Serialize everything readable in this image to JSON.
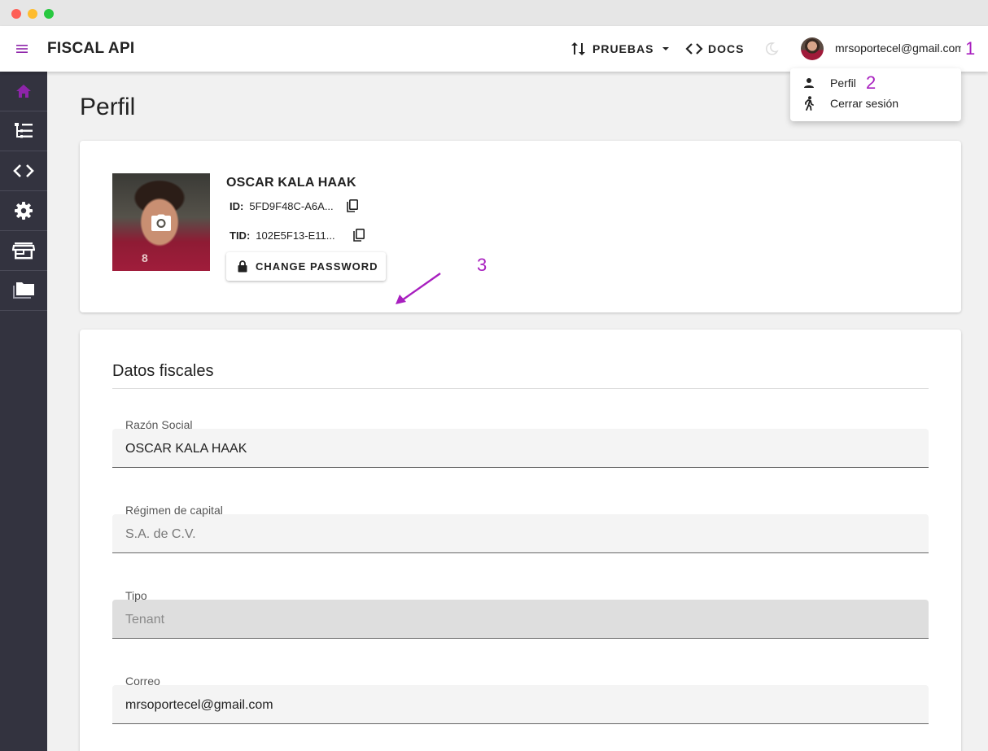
{
  "app": {
    "title": "FISCAL API"
  },
  "header": {
    "env_label": "PRUEBAS",
    "docs_label": "DOCS",
    "user_email": "mrsoportecel@gmail.com"
  },
  "user_menu": {
    "items": [
      {
        "label": "Perfil",
        "icon": "person-icon"
      },
      {
        "label": "Cerrar sesión",
        "icon": "walking-person-icon"
      }
    ]
  },
  "annotations": {
    "one": "1",
    "two": "2",
    "three": "3",
    "color": "#a81fbf"
  },
  "sidebar": {
    "items": [
      {
        "icon": "home-icon",
        "active": true
      },
      {
        "icon": "tree-list-icon"
      },
      {
        "icon": "code-icon"
      },
      {
        "icon": "gear-icon"
      },
      {
        "icon": "store-icon"
      },
      {
        "icon": "folders-icon"
      }
    ]
  },
  "page": {
    "title": "Perfil"
  },
  "profile": {
    "name": "OSCAR KALA HAAK",
    "id_label": "ID:",
    "id_value": "5FD9F48C-A6A...",
    "tid_label": "TID:",
    "tid_value": "102E5F13-E11...",
    "change_password_label": "CHANGE PASSWORD",
    "jersey_number": "8"
  },
  "fiscal": {
    "section_title": "Datos fiscales",
    "fields": [
      {
        "label": "Razón Social",
        "value": "OSCAR KALA HAAK"
      },
      {
        "label": "Régimen de capital",
        "value": "S.A. de C.V."
      },
      {
        "label": "Tipo",
        "value": "Tenant"
      },
      {
        "label": "Correo",
        "value": "mrsoportecel@gmail.com"
      }
    ]
  },
  "colors": {
    "accent": "#8e24aa",
    "sidebar_bg": "#33333f"
  }
}
